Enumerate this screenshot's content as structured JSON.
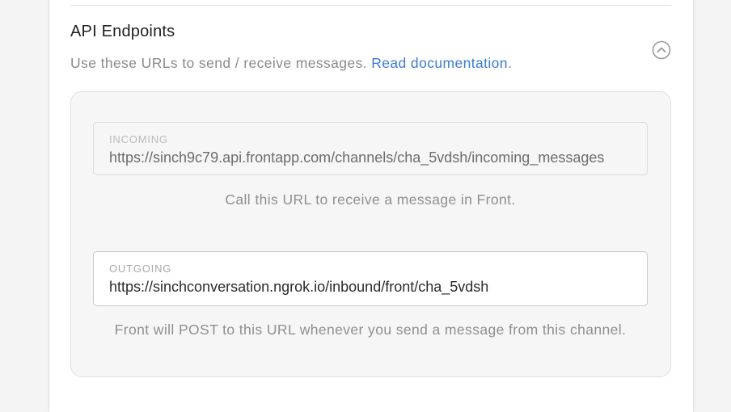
{
  "section": {
    "title": "API Endpoints",
    "description": "Use these URLs to send / receive messages.",
    "doc_link": "Read documentation",
    "doc_link_suffix": "."
  },
  "incoming": {
    "label": "INCOMING",
    "value": "https://sinch9c79.api.frontapp.com/channels/cha_5vdsh/incoming_messages",
    "help": "Call this URL to receive a message in Front."
  },
  "outgoing": {
    "label": "OUTGOING",
    "value": "https://sinchconversation.ngrok.io/inbound/front/cha_5vdsh",
    "help": "Front will POST to this URL whenever you send a message from this channel."
  },
  "icons": {
    "collapse": "chevron-up-circle-icon"
  },
  "colors": {
    "link": "#3b7bd6",
    "muted_text": "#8a8a8a",
    "panel_bg": "#f6f6f6"
  }
}
